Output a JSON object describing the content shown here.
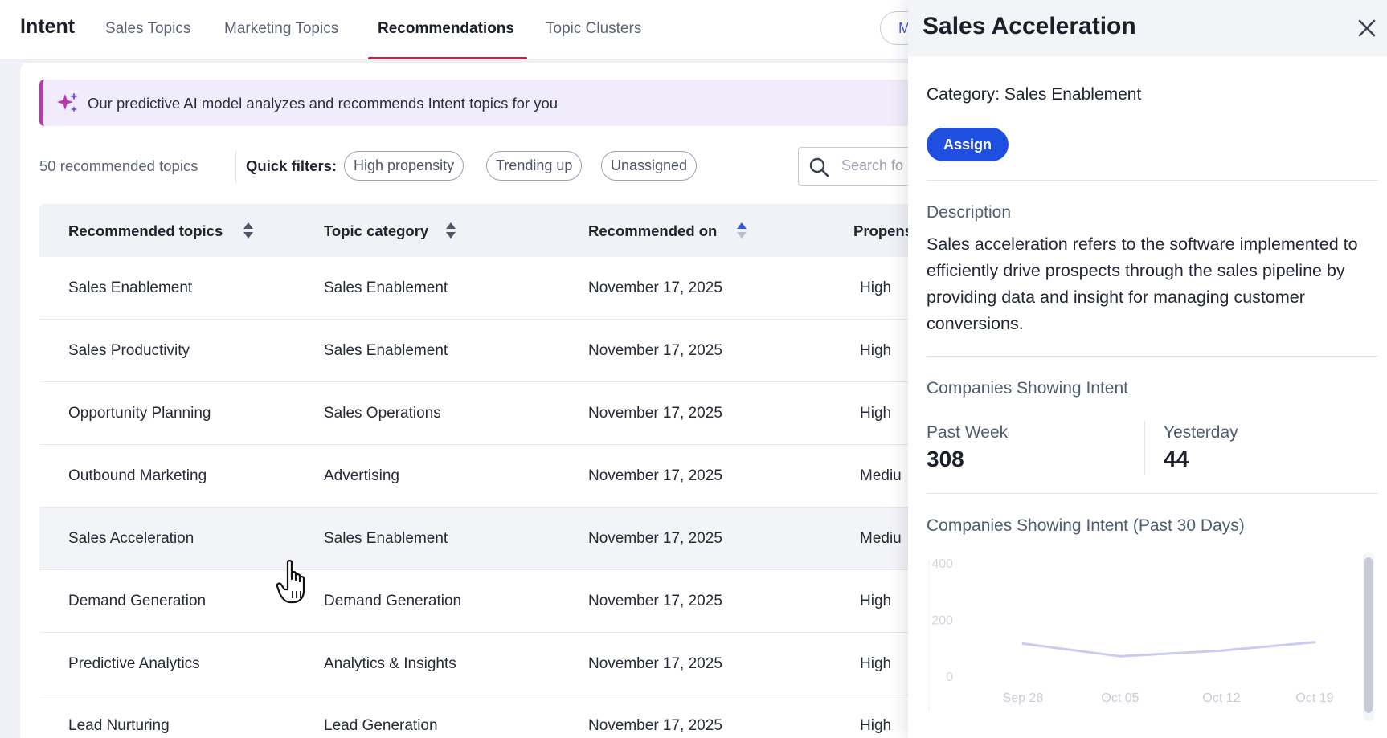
{
  "nav": {
    "brand": "Intent",
    "tabs": [
      {
        "label": "Sales Topics"
      },
      {
        "label": "Marketing Topics"
      },
      {
        "label": "Recommendations",
        "active": true
      },
      {
        "label": "Topic Clusters"
      }
    ],
    "pill_label": "M"
  },
  "banner": {
    "icon": "sparkles-icon",
    "text": "Our predictive AI model analyzes and recommends Intent topics for you",
    "accent": "#b83aa8"
  },
  "filters": {
    "count_text": "50 recommended topics",
    "quick_label": "Quick filters:",
    "chips": [
      "High propensity",
      "Trending up",
      "Unassigned"
    ]
  },
  "search": {
    "placeholder": "Search fo"
  },
  "table": {
    "headers": [
      "Recommended topics",
      "Topic category",
      "Recommended on",
      "Propens"
    ],
    "rows": [
      {
        "topic": "Sales Enablement",
        "category": "Sales Enablement",
        "date": "November 17, 2025",
        "propensity": "High"
      },
      {
        "topic": "Sales Productivity",
        "category": "Sales Enablement",
        "date": "November 17, 2025",
        "propensity": "High"
      },
      {
        "topic": "Opportunity Planning",
        "category": "Sales Operations",
        "date": "November 17, 2025",
        "propensity": "High"
      },
      {
        "topic": "Outbound Marketing",
        "category": "Advertising",
        "date": "November 17, 2025",
        "propensity": "Mediu"
      },
      {
        "topic": "Sales Acceleration",
        "category": "Sales Enablement",
        "date": "November 17, 2025",
        "propensity": "Mediu"
      },
      {
        "topic": "Demand Generation",
        "category": "Demand Generation",
        "date": "November 17, 2025",
        "propensity": "High"
      },
      {
        "topic": "Predictive Analytics",
        "category": "Analytics & Insights",
        "date": "November 17, 2025",
        "propensity": "High"
      },
      {
        "topic": "Lead Nurturing",
        "category": "Lead Generation",
        "date": "November 17, 2025",
        "propensity": "High"
      }
    ],
    "hovered_row": 4
  },
  "panel": {
    "title": "Sales Acceleration",
    "category_line": "Category: Sales Enablement",
    "assign_label": "Assign",
    "description_heading": "Description",
    "description": "Sales acceleration refers to the software implemented to efficiently drive prospects through the sales pipeline by providing data and insight for managing customer conversions.",
    "companies_heading": "Companies Showing Intent",
    "past_week_label": "Past Week",
    "past_week_value": "308",
    "yesterday_label": "Yesterday",
    "yesterday_value": "44",
    "chart_heading": "Companies Showing Intent (Past 30 Days)"
  },
  "chart_data": {
    "type": "line",
    "x": [
      "Sep 28",
      "Oct 05",
      "Oct 12",
      "Oct 19"
    ],
    "series": [
      {
        "values": [
          115,
          70,
          90,
          120
        ]
      }
    ],
    "yticks": [
      400,
      200,
      0
    ],
    "ylim": [
      0,
      400
    ],
    "color": "#c9ccf0",
    "grid": false
  },
  "colors": {
    "accent_blue": "#1f4fe0",
    "tab_underline": "#b8264a"
  }
}
